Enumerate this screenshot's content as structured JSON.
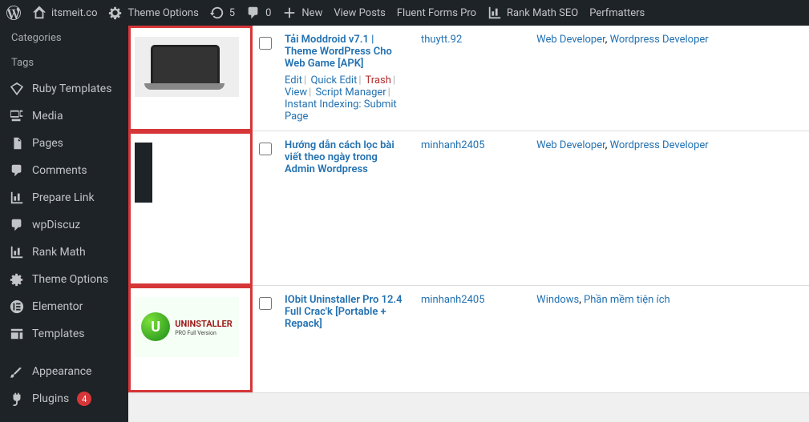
{
  "adminbar": {
    "site_name": "itsmeit.co",
    "theme_options": "Theme Options",
    "refresh_count": "5",
    "comments_count": "0",
    "new_label": "New",
    "view_posts": "View Posts",
    "fluent_forms": "Fluent Forms Pro",
    "rank_math": "Rank Math SEO",
    "perfmatters": "Perfmatters"
  },
  "sidebar": {
    "categories": "Categories",
    "tags": "Tags",
    "ruby_templates": "Ruby Templates",
    "media": "Media",
    "pages": "Pages",
    "comments": "Comments",
    "prepare_link": "Prepare Link",
    "wpdiscuz": "wpDiscuz",
    "rank_math": "Rank Math",
    "theme_options": "Theme Options",
    "elementor": "Elementor",
    "templates": "Templates",
    "appearance": "Appearance",
    "plugins": "Plugins",
    "plugins_badge": "4"
  },
  "posts": [
    {
      "title": "Tải Moddroid v7.1 | Theme WordPress Cho Web Game [APK]",
      "author": "thuytt.92",
      "categories": [
        {
          "name": "Web Developer"
        },
        {
          "name": "Wordpress Developer"
        }
      ],
      "actions": {
        "edit": "Edit",
        "quick_edit": "Quick Edit",
        "trash": "Trash",
        "view": "View",
        "script_manager": "Script Manager",
        "instant_indexing": "Instant Indexing: Submit Page"
      }
    },
    {
      "title": "Hướng dẫn cách lọc bài viết theo ngày trong Admin Wordpress",
      "author": "minhanh2405",
      "categories": [
        {
          "name": "Web Developer"
        },
        {
          "name": "Wordpress Developer"
        }
      ]
    },
    {
      "title": "IObit Uninstaller Pro 12.4 Full Crac'k [Portable + Repack]",
      "author": "minhanh2405",
      "categories": [
        {
          "name": "Windows"
        },
        {
          "name": "Phần mềm tiện ích"
        }
      ]
    }
  ],
  "iobit_label": "UNINSTALLER",
  "iobit_sub": "PRO Full Version"
}
